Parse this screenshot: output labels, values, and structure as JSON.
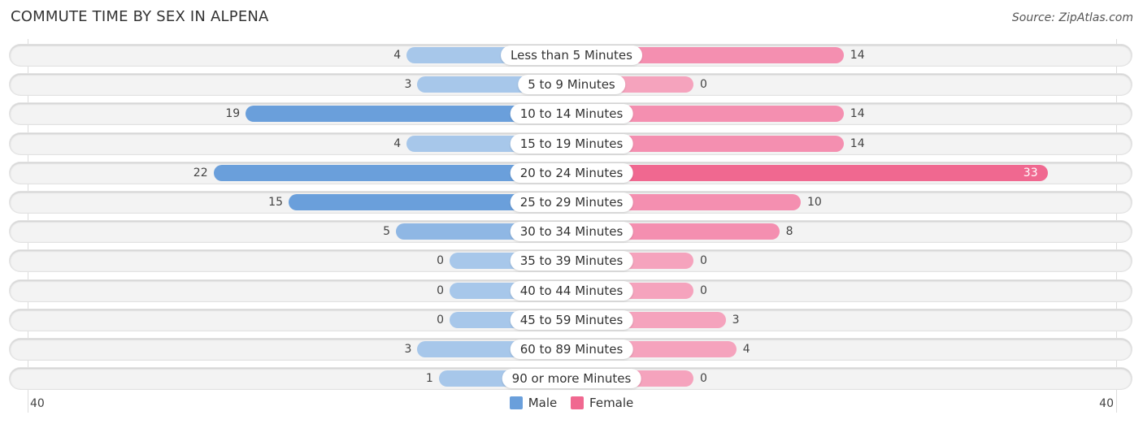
{
  "title": "COMMUTE TIME BY SEX IN ALPENA",
  "source": "Source: ZipAtlas.com",
  "colors": {
    "male": "#6a9fdb",
    "male_light": "#a7c7ea",
    "female": "#f06890",
    "female_light": "#f5a3bd"
  },
  "chart_data": {
    "type": "bar",
    "orientation": "horizontal-diverging",
    "title": "COMMUTE TIME BY SEX IN ALPENA",
    "categories": [
      "Less than 5 Minutes",
      "5 to 9 Minutes",
      "10 to 14 Minutes",
      "15 to 19 Minutes",
      "20 to 24 Minutes",
      "25 to 29 Minutes",
      "30 to 34 Minutes",
      "35 to 39 Minutes",
      "40 to 44 Minutes",
      "45 to 59 Minutes",
      "60 to 89 Minutes",
      "90 or more Minutes"
    ],
    "series": [
      {
        "name": "Male",
        "values": [
          4,
          3,
          19,
          4,
          22,
          15,
          5,
          0,
          0,
          0,
          3,
          1
        ]
      },
      {
        "name": "Female",
        "values": [
          14,
          0,
          14,
          14,
          33,
          10,
          8,
          0,
          0,
          3,
          4,
          0
        ]
      }
    ],
    "axis": {
      "left_label": "40",
      "right_label": "40",
      "range": [
        -40,
        40
      ]
    },
    "legend": {
      "entries": [
        "Male",
        "Female"
      ],
      "position": "bottom-center"
    },
    "grid": false
  }
}
